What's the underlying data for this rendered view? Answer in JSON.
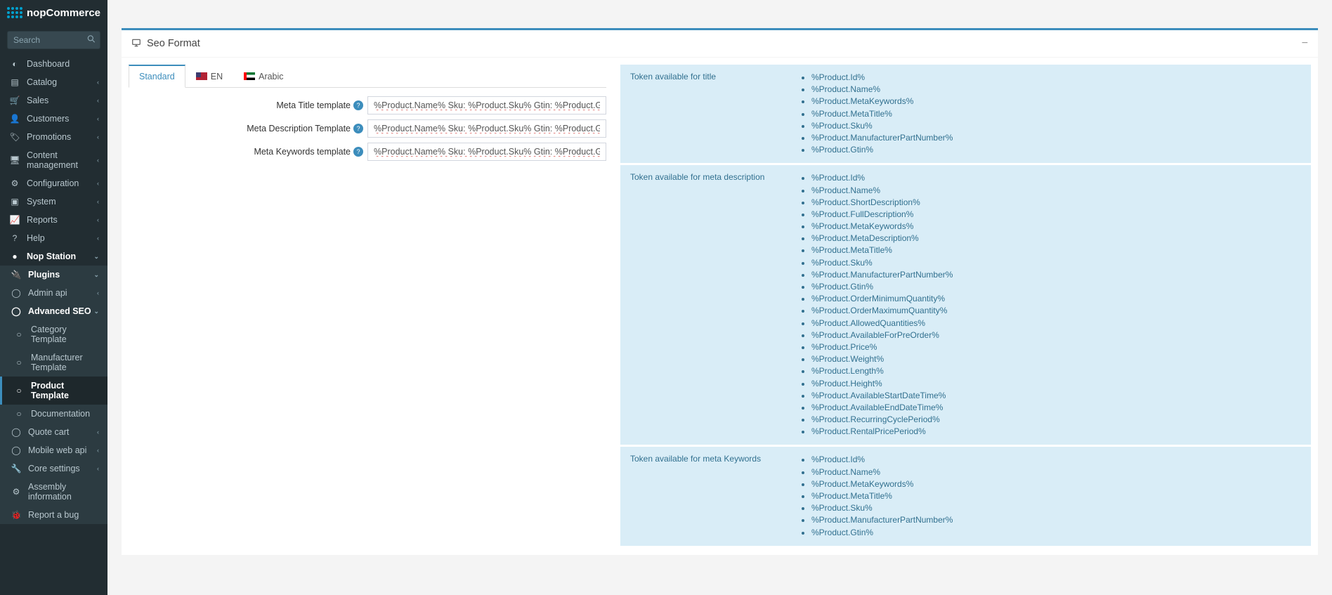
{
  "brand": "nopCommerce",
  "search": {
    "placeholder": "Search"
  },
  "sidebar": {
    "items": [
      {
        "label": "Dashboard",
        "icon": "tachometer"
      },
      {
        "label": "Catalog",
        "icon": "book",
        "expand": true
      },
      {
        "label": "Sales",
        "icon": "cart",
        "expand": true
      },
      {
        "label": "Customers",
        "icon": "user",
        "expand": true
      },
      {
        "label": "Promotions",
        "icon": "tags",
        "expand": true
      },
      {
        "label": "Content management",
        "icon": "desktop",
        "expand": true
      },
      {
        "label": "Configuration",
        "icon": "cogs",
        "expand": true
      },
      {
        "label": "System",
        "icon": "cubes",
        "expand": true
      },
      {
        "label": "Reports",
        "icon": "chart",
        "expand": true
      },
      {
        "label": "Help",
        "icon": "question",
        "expand": true
      },
      {
        "label": "Nop Station",
        "icon": "circle-solid",
        "expand": true,
        "open": true
      }
    ],
    "nopstation": {
      "plugins": "Plugins",
      "sub": [
        {
          "label": "Admin api",
          "icon": "circle-o",
          "expand": true
        },
        {
          "label": "Advanced SEO",
          "icon": "circle-o",
          "expand": true,
          "open": true
        },
        {
          "label": "Quote cart",
          "icon": "circle-o",
          "expand": true
        },
        {
          "label": "Mobile web api",
          "icon": "circle-o",
          "expand": true
        },
        {
          "label": "Core settings",
          "icon": "wrench",
          "expand": true
        },
        {
          "label": "Assembly information",
          "icon": "gear"
        },
        {
          "label": "Report a bug",
          "icon": "bug"
        }
      ],
      "advseo": [
        {
          "label": "Category Template"
        },
        {
          "label": "Manufacturer Template"
        },
        {
          "label": "Product Template",
          "active": true
        },
        {
          "label": "Documentation"
        }
      ]
    }
  },
  "panel": {
    "title": "Seo Format",
    "tabs": {
      "standard": "Standard",
      "en": "EN",
      "arabic": "Arabic"
    },
    "fields": {
      "metaTitle": {
        "label": "Meta Title template",
        "value": "%Product.Name% Sku: %Product.Sku% Gtin: %Product.Gtin% %Product.MetaTitle%"
      },
      "metaDesc": {
        "label": "Meta Description Template",
        "value": "%Product.Name% Sku: %Product.Sku% Gtin: %Product.Gtin% %Product.ShortDescription% %Product.MetaDescription%"
      },
      "metaKeywords": {
        "label": "Meta Keywords template",
        "value": "%Product.Name% Sku: %Product.Sku% Gtin: %Product.Gtin% %Product.ManufacturerPartNumber% %Product.MetaKeywords%"
      }
    }
  },
  "tokens": {
    "title": {
      "heading": "Token available for title",
      "list": [
        "%Product.Id%",
        "%Product.Name%",
        "%Product.MetaKeywords%",
        "%Product.MetaTitle%",
        "%Product.Sku%",
        "%Product.ManufacturerPartNumber%",
        "%Product.Gtin%"
      ]
    },
    "desc": {
      "heading": "Token available for meta description",
      "list": [
        "%Product.Id%",
        "%Product.Name%",
        "%Product.ShortDescription%",
        "%Product.FullDescription%",
        "%Product.MetaKeywords%",
        "%Product.MetaDescription%",
        "%Product.MetaTitle%",
        "%Product.Sku%",
        "%Product.ManufacturerPartNumber%",
        "%Product.Gtin%",
        "%Product.OrderMinimumQuantity%",
        "%Product.OrderMaximumQuantity%",
        "%Product.AllowedQuantities%",
        "%Product.AvailableForPreOrder%",
        "%Product.Price%",
        "%Product.Weight%",
        "%Product.Length%",
        "%Product.Height%",
        "%Product.AvailableStartDateTime%",
        "%Product.AvailableEndDateTime%",
        "%Product.RecurringCyclePeriod%",
        "%Product.RentalPricePeriod%"
      ]
    },
    "keywords": {
      "heading": "Token available for meta Keywords",
      "list": [
        "%Product.Id%",
        "%Product.Name%",
        "%Product.MetaKeywords%",
        "%Product.MetaTitle%",
        "%Product.Sku%",
        "%Product.ManufacturerPartNumber%",
        "%Product.Gtin%"
      ]
    }
  }
}
